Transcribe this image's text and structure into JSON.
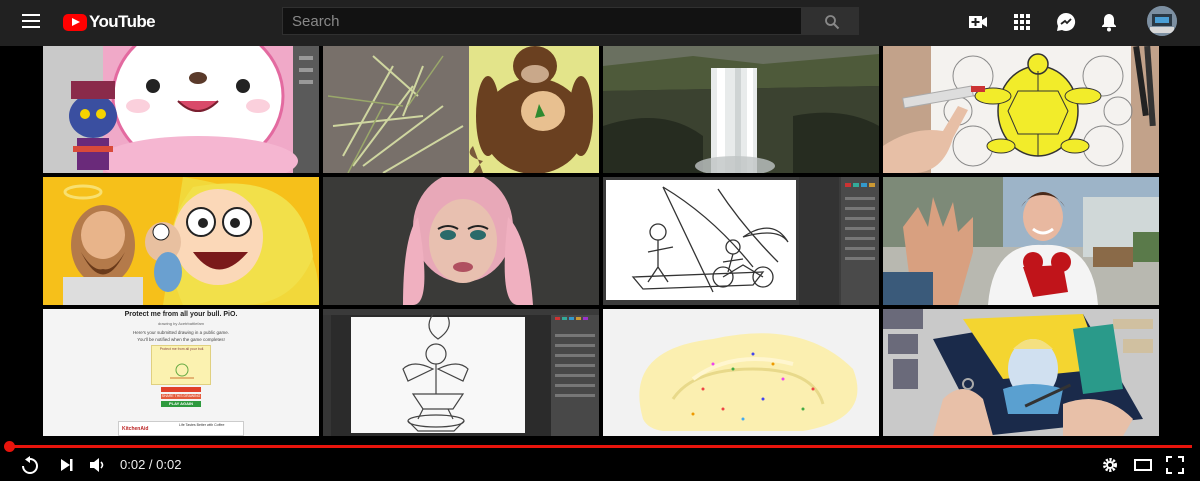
{
  "header": {
    "logo_text": "YouTube",
    "search_placeholder": "Search",
    "icons": [
      "menu-icon",
      "create-video-icon",
      "apps-grid-icon",
      "messages-icon",
      "notifications-bell-icon",
      "avatar"
    ]
  },
  "colors": {
    "topbar_bg": "#212121",
    "accent_red": "#ff0000",
    "progress_red": "#e8140c",
    "background": "#000000"
  },
  "thumbnails": [
    {
      "id": "cartoon-cat-drawing"
    },
    {
      "id": "palm-leaves-gorilla"
    },
    {
      "id": "waterfall"
    },
    {
      "id": "turtle-coloring"
    },
    {
      "id": "comic-characters"
    },
    {
      "id": "pink-hair-makeup"
    },
    {
      "id": "sketch-sailboat"
    },
    {
      "id": "boy-high-five"
    },
    {
      "id": "drawing-game-page"
    },
    {
      "id": "sketch-figure"
    },
    {
      "id": "yellow-slime"
    },
    {
      "id": "painting-box"
    }
  ],
  "game_page": {
    "title": "Protect me from all your bull. PiO.",
    "subtitle": "drawing by Acetrbattlefam",
    "line1": "Here's your submitted drawing in a public game.",
    "line2": "You'll be notified when the game completes!",
    "sticky_text": "Protect me from all your bull.",
    "btn1": "",
    "btn2": "SHARE THIS DRAWING",
    "btn3": "PLAY AGAIN",
    "ad_text": "Life Tastes Better with Coffee",
    "ad_brand": "KitchenAid"
  },
  "player": {
    "time_display": "0:02 / 0:02",
    "progress": 1.0
  }
}
